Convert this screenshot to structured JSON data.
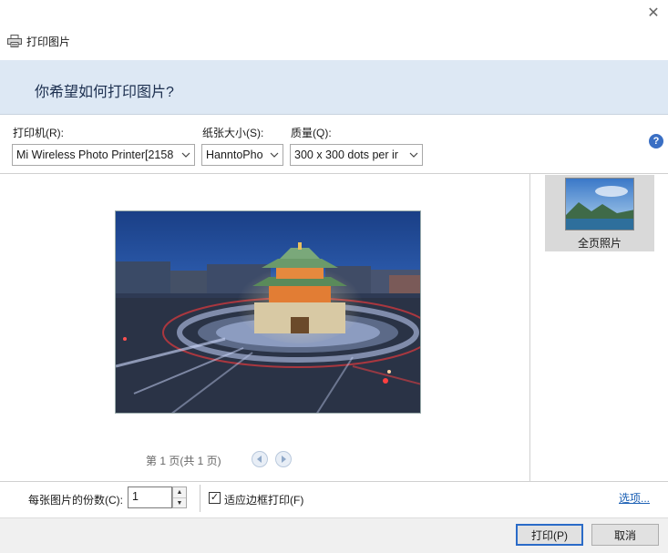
{
  "window": {
    "title": "打印图片",
    "close_label": "✕"
  },
  "header": {
    "question": "你希望如何打印图片?"
  },
  "settings": {
    "printer_label": "打印机(R):",
    "printer_value": "Mi Wireless Photo Printer[2158",
    "paper_label": "纸张大小(S):",
    "paper_value": "HanntoPho",
    "quality_label": "质量(Q):",
    "quality_value": "300 x 300 dots per ir",
    "help_label": "?"
  },
  "preview": {
    "page_indicator": "第 1 页(共 1 页)"
  },
  "layouts": {
    "items": [
      {
        "label": "全页照片",
        "selected": true
      }
    ]
  },
  "copies": {
    "label": "每张图片的份数(C):",
    "value": "1"
  },
  "fit_frame": {
    "label": "适应边框打印(F)",
    "checked": true,
    "check_glyph": "✓"
  },
  "options_link": "选项...",
  "buttons": {
    "print": "打印(P)",
    "cancel": "取消"
  },
  "colors": {
    "header_band": "#dde8f4",
    "accent": "#2a6bc8",
    "link": "#1a5fb4",
    "selected_tile": "#d9d9d9"
  }
}
